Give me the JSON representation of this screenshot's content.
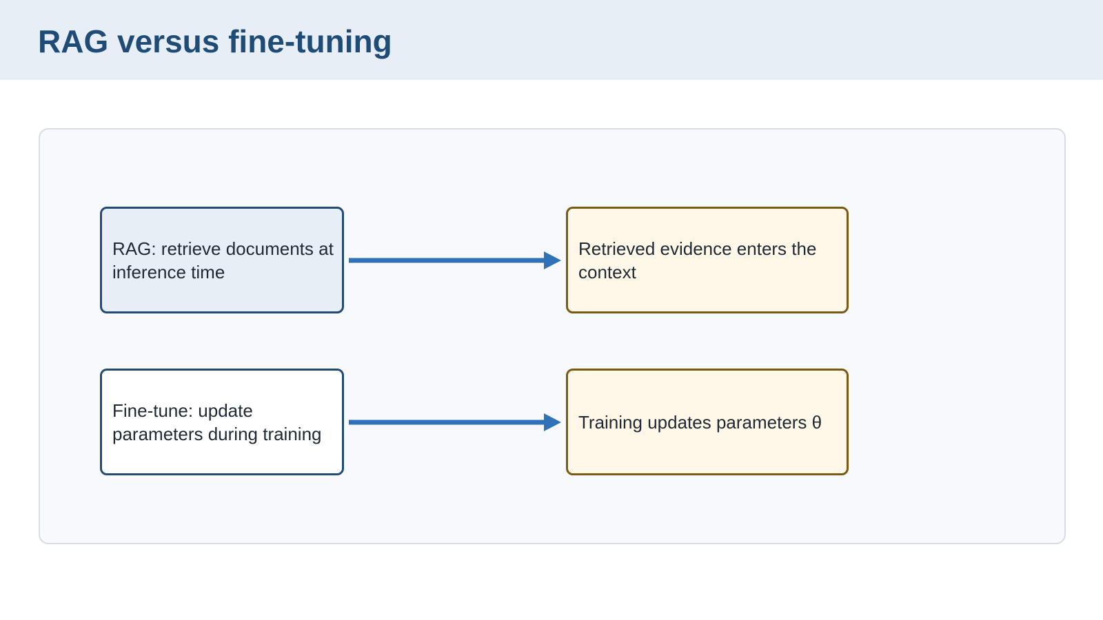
{
  "header": {
    "title": "RAG versus fine-tuning"
  },
  "diagram": {
    "nodes": {
      "rag": "RAG: retrieve documents at inference time",
      "fine_tune": "Fine-tune: update parameters during training",
      "retrieved_evidence": "Retrieved evidence enters the context",
      "training_updates": "Training updates parameters θ"
    },
    "connectors": [
      {
        "from": "RAG: retrieve documents at inference time",
        "to": "Retrieved evidence enters the context"
      },
      {
        "from": "Fine-tune: update parameters during training",
        "to": "Training updates parameters θ"
      }
    ]
  },
  "colors": {
    "header_background": "#e8eef6",
    "title": "#1f4b77",
    "panel_background": "#f7f9fc",
    "panel_border": "#d6dde6",
    "source_border": "#214b75",
    "rag_fill": "#e8eef6",
    "fine_tune_fill": "#ffffff",
    "result_fill": "#fff7e8",
    "result_border": "#7a5a12",
    "arrow": "#2f72b8",
    "text": "#1f2933"
  }
}
